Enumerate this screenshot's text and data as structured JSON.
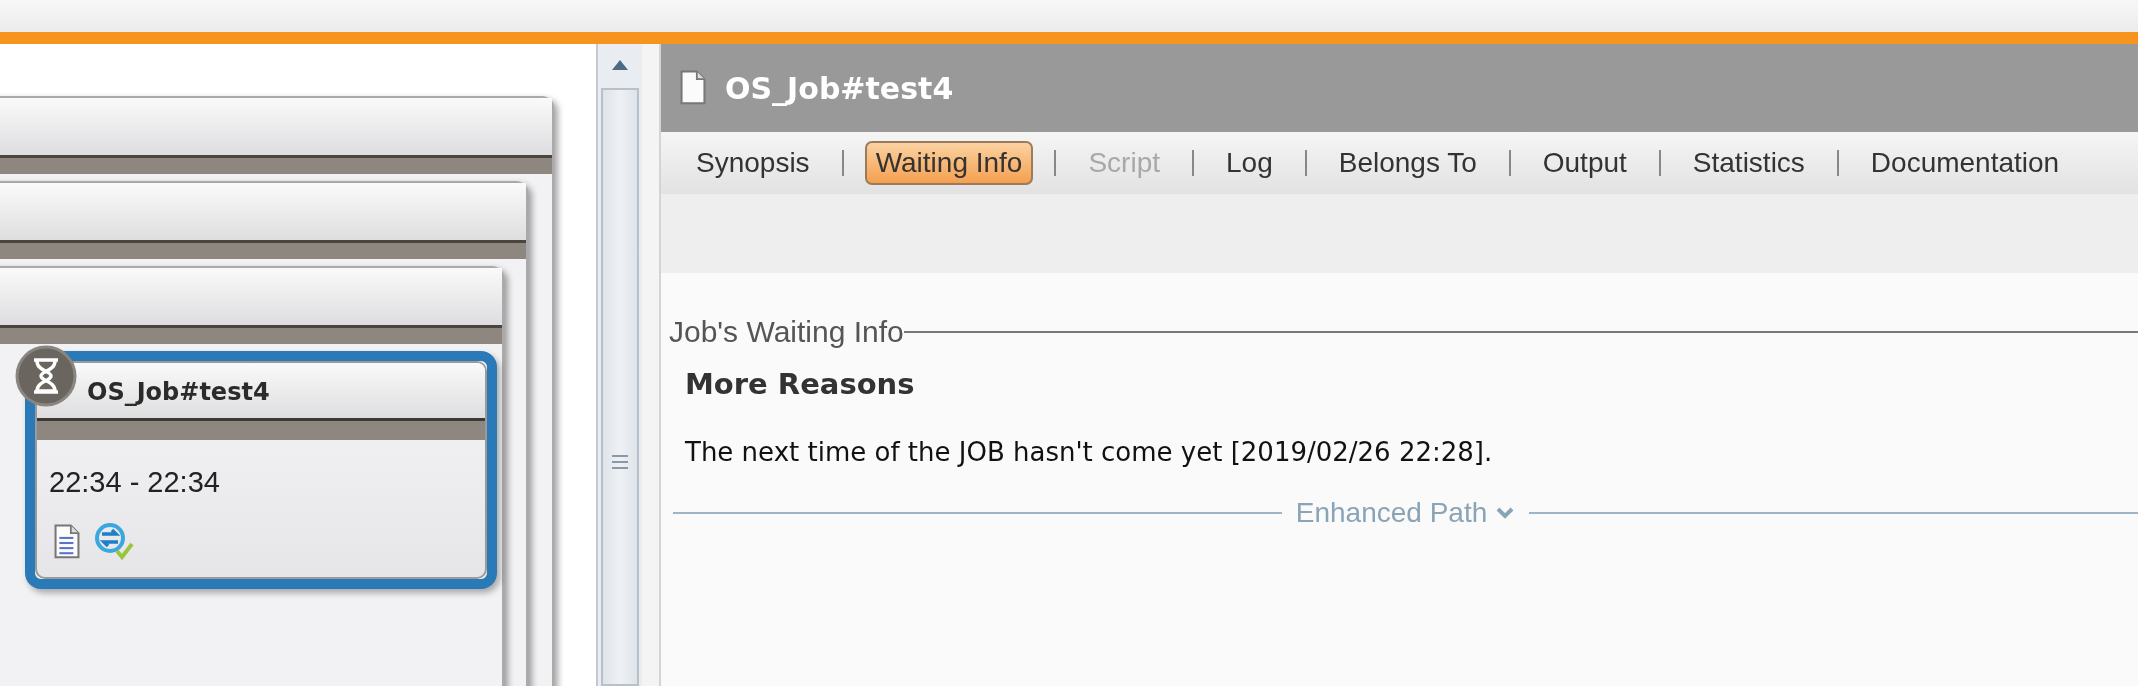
{
  "job_card": {
    "title": "OS_Job#test4",
    "time": "22:34 - 22:34",
    "selected": true
  },
  "detail": {
    "title": "OS_Job#test4",
    "tabs": [
      {
        "label": "Synopsis",
        "selected": false,
        "disabled": false
      },
      {
        "label": "Waiting Info",
        "selected": true,
        "disabled": false
      },
      {
        "label": "Script",
        "selected": false,
        "disabled": true
      },
      {
        "label": "Log",
        "selected": false,
        "disabled": false
      },
      {
        "label": "Belongs To",
        "selected": false,
        "disabled": false
      },
      {
        "label": "Output",
        "selected": false,
        "disabled": false
      },
      {
        "label": "Statistics",
        "selected": false,
        "disabled": false
      },
      {
        "label": "Documentation",
        "selected": false,
        "disabled": false
      }
    ],
    "section": {
      "legend": "Job's Waiting Info",
      "heading": "More Reasons",
      "text": "The next time of the JOB hasn't come yet [2019/02/26 22:28].",
      "expander": {
        "label": "Enhanced Path",
        "expanded": false
      }
    }
  }
}
